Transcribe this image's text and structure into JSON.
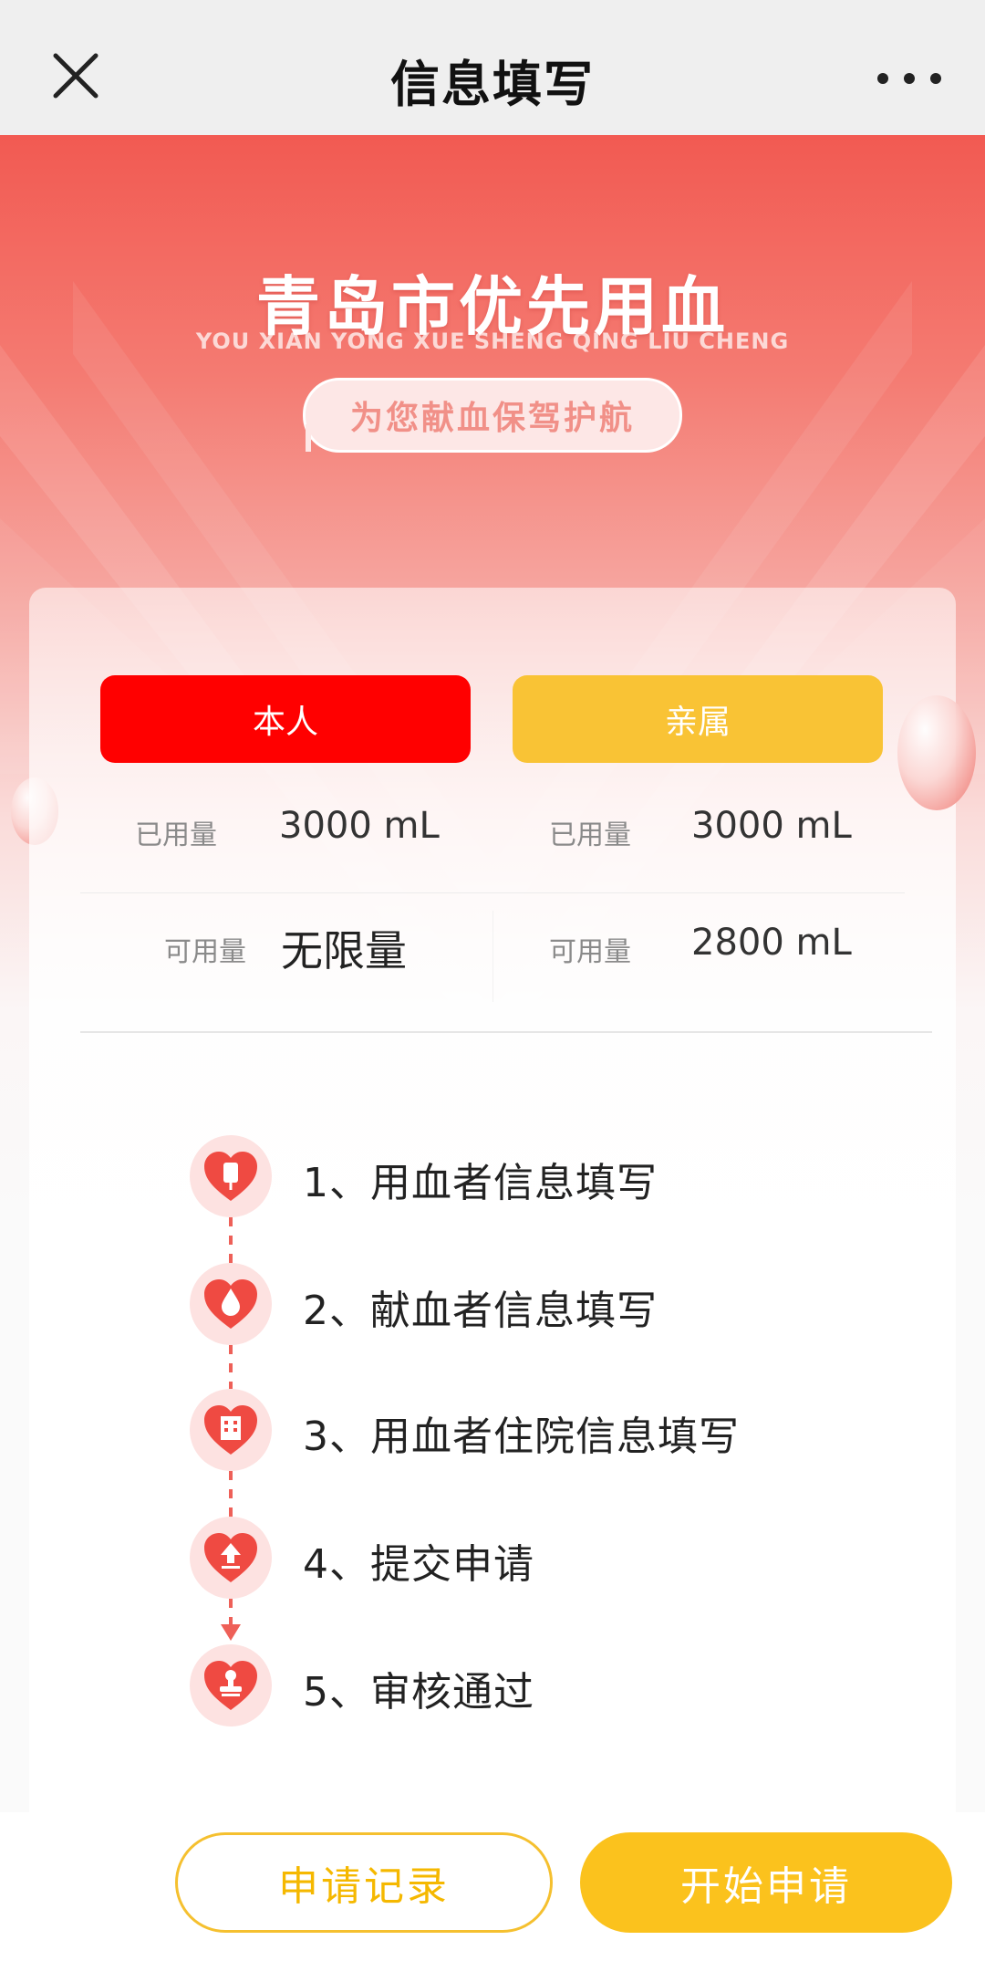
{
  "topbar": {
    "title": "信息填写",
    "close_icon": "close-icon",
    "more_icon": "more-dots-icon"
  },
  "hero": {
    "title": "青岛市优先用血",
    "subtitle": "YOU XIAN YONG XUE SHENG QING LIU CHENG",
    "slogan": "为您献血保驾护航"
  },
  "tabs": {
    "self": "本人",
    "relative": "亲属"
  },
  "stats": {
    "self": {
      "used_label": "已用量",
      "used_value": "3000 mL",
      "available_label": "可用量",
      "available_value": "无限量"
    },
    "relative": {
      "used_label": "已用量",
      "used_value": "3000 mL",
      "available_label": "可用量",
      "available_value": "2800 mL"
    }
  },
  "steps": [
    {
      "text": "1、用血者信息填写",
      "icon": "blood-bag-heart-icon"
    },
    {
      "text": "2、献血者信息填写",
      "icon": "blood-drop-heart-icon"
    },
    {
      "text": "3、用血者住院信息填写",
      "icon": "hospital-heart-icon"
    },
    {
      "text": "4、提交申请",
      "icon": "upload-heart-icon"
    },
    {
      "text": "5、审核通过",
      "icon": "stamp-heart-icon"
    }
  ],
  "bottom": {
    "record_label": "申请记录",
    "start_label": "开始申请"
  },
  "colors": {
    "accent_red": "#ff0000",
    "accent_yellow": "#fbc21d",
    "hero_red": "#f25a52"
  }
}
